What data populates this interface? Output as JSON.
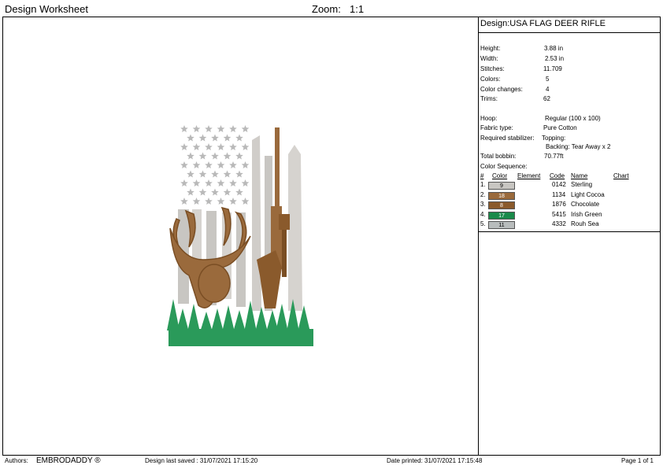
{
  "header": {
    "title": "Design Worksheet",
    "zoom_label": "Zoom:",
    "zoom_value": "1:1"
  },
  "design_name": "Design:USA FLAG DEER RIFLE",
  "specs": [
    {
      "label": "Height:",
      "value": "3.88 in"
    },
    {
      "label": "Width:",
      "value": "2.53 in"
    },
    {
      "label": "Stitches:",
      "value": "11.709"
    },
    {
      "label": "Colors:",
      "value": "5"
    },
    {
      "label": "Color changes:",
      "value": "4"
    },
    {
      "label": "Trims:",
      "value": "62"
    }
  ],
  "hoop": {
    "label": "Hoop:",
    "value": "Regular (100 x 100)"
  },
  "fabric": {
    "label": "Fabric type:",
    "value": "Pure Cotton"
  },
  "stabilizer": {
    "label": "Required stabilizer:",
    "topping": "Topping:",
    "backing": "Backing: Tear Away x 2"
  },
  "bobbin": {
    "label": "Total bobbin:",
    "value": "70.77ft"
  },
  "sequence": {
    "title": "Color Sequence:",
    "headers": [
      "#",
      "Color",
      "Element",
      "Code",
      "Name",
      "Chart"
    ],
    "rows": [
      {
        "num": "1.",
        "swatch": "9",
        "color": "#c8c6c2",
        "code": "0142",
        "name": "Sterling"
      },
      {
        "num": "2.",
        "swatch": "18",
        "color": "#9a6a3c",
        "code": "1134",
        "name": "Light Cocoa"
      },
      {
        "num": "3.",
        "swatch": "8",
        "color": "#8a5a2c",
        "code": "1876",
        "name": "Chocolate"
      },
      {
        "num": "4.",
        "swatch": "17",
        "color": "#1a8a4a",
        "code": "5415",
        "name": "Irish Green"
      },
      {
        "num": "5.",
        "swatch": "11",
        "color": "#b8bcbc",
        "code": "4332",
        "name": "Rouh Sea"
      }
    ]
  },
  "footer": {
    "authors_label": "Authors:",
    "authors_value": "EMBRODADDY ®",
    "saved": "Design last saved : 31/07/2021 17:15:20",
    "printed": "Date printed: 31/07/2021 17:15:48",
    "page": "Page 1 of 1"
  }
}
